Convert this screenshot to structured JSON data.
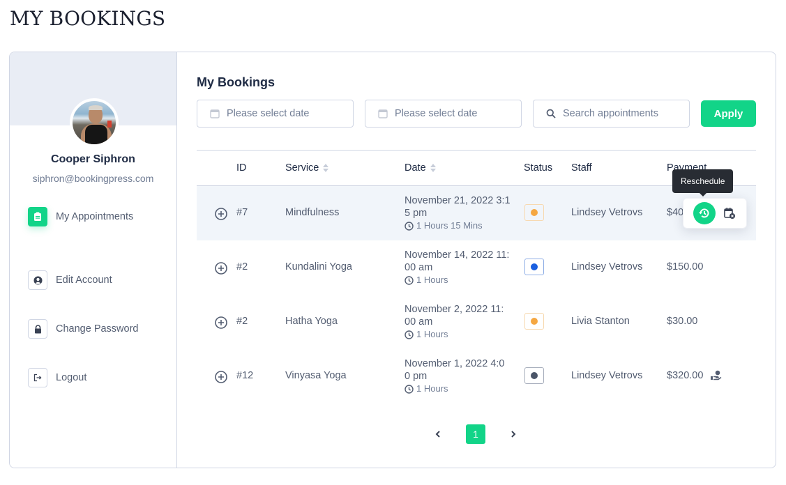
{
  "page": {
    "title": "MY BOOKINGS"
  },
  "sidebar": {
    "user": {
      "name": "Cooper Siphron",
      "email": "siphron@bookingpress.com"
    },
    "items": [
      {
        "label": "My Appointments",
        "icon": "clipboard-icon",
        "active": true
      },
      {
        "label": "Edit Account",
        "icon": "user-circle-icon",
        "active": false
      },
      {
        "label": "Change Password",
        "icon": "lock-icon",
        "active": false
      },
      {
        "label": "Logout",
        "icon": "logout-icon",
        "active": false
      }
    ]
  },
  "main": {
    "title": "My Bookings",
    "filters": {
      "start_date_placeholder": "Please select date",
      "end_date_placeholder": "Please select date",
      "search_placeholder": "Search appointments",
      "apply_label": "Apply"
    },
    "table": {
      "columns": [
        "ID",
        "Service",
        "Date",
        "Status",
        "Staff",
        "Payment"
      ],
      "rows": [
        {
          "id": "#7",
          "service": "Mindfulness",
          "date_line1": "November 21, 2022 3:1",
          "date_line2": "5 pm",
          "duration": "1 Hours 15 Mins",
          "status_color": "#f5a742",
          "status_border": "#f7d9b0",
          "staff": "Lindsey Vetrovs",
          "payment": "$400.00",
          "highlighted": true
        },
        {
          "id": "#2",
          "service": "Kundalini Yoga",
          "date_line1": "November 14, 2022 11:",
          "date_line2": "00 am",
          "duration": "1 Hours",
          "status_color": "#1a5fe0",
          "status_border": "#90afe6",
          "staff": "Lindsey Vetrovs",
          "payment": "$150.00"
        },
        {
          "id": "#2",
          "service": "Hatha Yoga",
          "date_line1": "November 2, 2022 11:",
          "date_line2": "00 am",
          "duration": "1 Hours",
          "status_color": "#f5a742",
          "status_border": "#f7d9b0",
          "staff": "Livia Stanton",
          "payment": "$30.00"
        },
        {
          "id": "#12",
          "service": "Vinyasa Yoga",
          "date_line1": "November 1, 2022 4:0",
          "date_line2": "0 pm",
          "duration": "1 Hours",
          "status_color": "#4a5568",
          "status_border": "#a8afbd",
          "staff": "Lindsey Vetrovs",
          "payment": "$320.00",
          "payment_icon": "hand-coin-icon"
        }
      ]
    },
    "row_actions": {
      "tooltip": "Reschedule",
      "reschedule_icon": "history-icon",
      "cancel_icon": "calendar-cancel-icon"
    },
    "pagination": {
      "current_page": "1"
    }
  },
  "colors": {
    "accent": "#12d488",
    "text_dark": "#202c45",
    "text_muted": "#535d71",
    "border": "#d0d6e4"
  }
}
